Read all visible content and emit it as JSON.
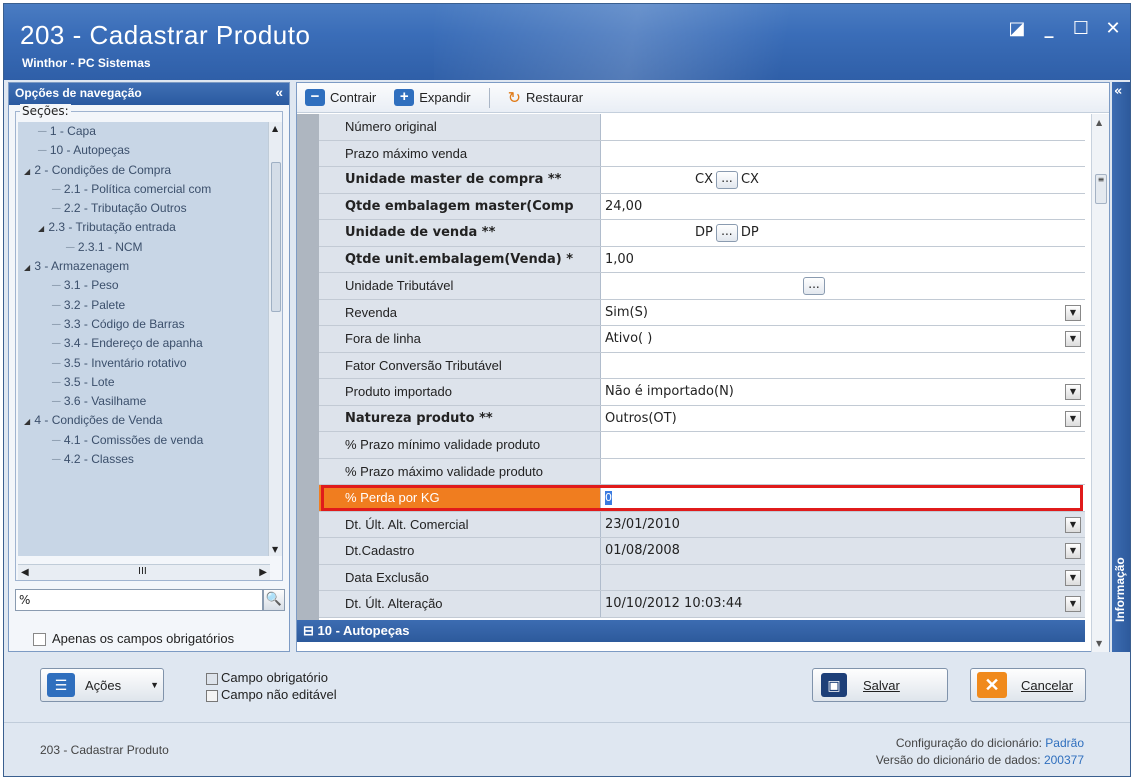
{
  "window": {
    "title": "203 - Cadastrar  Produto",
    "subtitle": "Winthor - PC Sistemas",
    "controls": [
      "◪",
      "_",
      "☐",
      "✕"
    ]
  },
  "nav": {
    "header": "Opções de navegação",
    "collapse": "«",
    "sections_label": "Seções:",
    "items": [
      {
        "label": "1 - Capa",
        "indent": 1,
        "tri": ""
      },
      {
        "label": "10 - Autopeças",
        "indent": 1,
        "tri": ""
      },
      {
        "label": "2 - Condições de Compra",
        "indent": 0,
        "tri": "◢"
      },
      {
        "label": "2.1 - Política comercial com",
        "indent": 2,
        "tri": ""
      },
      {
        "label": "2.2 - Tributação Outros",
        "indent": 2,
        "tri": ""
      },
      {
        "label": "2.3 - Tributação entrada",
        "indent": 1,
        "tri": "◢"
      },
      {
        "label": "2.3.1 - NCM",
        "indent": 3,
        "tri": ""
      },
      {
        "label": "3 - Armazenagem",
        "indent": 0,
        "tri": "◢"
      },
      {
        "label": "3.1 - Peso",
        "indent": 2,
        "tri": ""
      },
      {
        "label": "3.2 - Palete",
        "indent": 2,
        "tri": ""
      },
      {
        "label": "3.3 - Código de Barras",
        "indent": 2,
        "tri": ""
      },
      {
        "label": "3.4 - Endereço de apanha",
        "indent": 2,
        "tri": ""
      },
      {
        "label": "3.5 - Inventário rotativo",
        "indent": 2,
        "tri": ""
      },
      {
        "label": "3.5 - Lote",
        "indent": 2,
        "tri": ""
      },
      {
        "label": "3.6 - Vasilhame",
        "indent": 2,
        "tri": ""
      },
      {
        "label": "4 - Condições de Venda",
        "indent": 0,
        "tri": "◢"
      },
      {
        "label": "4.1 - Comissões de venda",
        "indent": 2,
        "tri": ""
      },
      {
        "label": "4.2 - Classes",
        "indent": 2,
        "tri": ""
      }
    ],
    "hscroll_mark": "III",
    "search_value": "%",
    "only_required_label": "Apenas os campos obrigatórios"
  },
  "toolbar": {
    "contrair": "Contrair",
    "expandir": "Expandir",
    "restaurar": "Restaurar"
  },
  "grid": {
    "rows": [
      {
        "label": "Número original",
        "value": "",
        "bold": false,
        "type": "text"
      },
      {
        "label": "Prazo máximo venda",
        "value": "",
        "bold": false,
        "type": "text"
      },
      {
        "label": "Unidade master de compra **",
        "value": "CX",
        "value2": "CX",
        "bold": true,
        "type": "lookup"
      },
      {
        "label": "Qtde embalagem master(Comp",
        "value": "24,00",
        "bold": true,
        "type": "text"
      },
      {
        "label": "Unidade de venda **",
        "value": "DP",
        "value2": "DP",
        "bold": true,
        "type": "lookup"
      },
      {
        "label": "Qtde unit.embalagem(Venda) *",
        "value": "1,00",
        "bold": true,
        "type": "text"
      },
      {
        "label": "Unidade Tributável",
        "value": "",
        "value2": "",
        "bold": false,
        "type": "lookup"
      },
      {
        "label": "Revenda",
        "value": "Sim(S)",
        "bold": false,
        "type": "dropdown"
      },
      {
        "label": "Fora de linha",
        "value": "Ativo( )",
        "bold": false,
        "type": "dropdown"
      },
      {
        "label": "Fator Conversão Tributável",
        "value": "",
        "bold": false,
        "type": "text"
      },
      {
        "label": "Produto importado",
        "value": "Não é importado(N)",
        "bold": false,
        "type": "dropdown"
      },
      {
        "label": "Natureza produto **",
        "value": "Outros(OT)",
        "bold": true,
        "type": "dropdown"
      },
      {
        "label": "% Prazo mínimo validade produto",
        "value": "",
        "bold": false,
        "type": "text"
      },
      {
        "label": "% Prazo máximo validade produto",
        "value": "",
        "bold": false,
        "type": "text"
      },
      {
        "label": "% Perda por KG",
        "value": "0",
        "bold": false,
        "type": "highlight"
      },
      {
        "label": "Dt. Últ. Alt. Comercial",
        "value": "23/01/2010",
        "bold": false,
        "type": "dropdown-grey"
      },
      {
        "label": "Dt.Cadastro",
        "value": "01/08/2008",
        "bold": false,
        "type": "dropdown-grey"
      },
      {
        "label": "Data Exclusão",
        "value": "",
        "bold": false,
        "type": "dropdown-grey"
      },
      {
        "label": "Dt. Últ. Alteração",
        "value": "10/10/2012 10:03:44",
        "bold": false,
        "type": "dropdown-grey"
      }
    ],
    "group_label": "10 - Autopeças"
  },
  "info_strip": {
    "label": "Informação",
    "chev": "«"
  },
  "bottom": {
    "acoes": "Ações",
    "legend_required": "Campo obrigatório",
    "legend_noneditable": "Campo não editável",
    "salvar": "Salvar",
    "cancelar": "Cancelar"
  },
  "footer": {
    "left": "203 - Cadastrar  Produto",
    "dict_config_label": "Configuração do dicionário:",
    "dict_config_value": "Padrão",
    "dict_version_label": "Versão do dicionário de dados:",
    "dict_version_value": "200377"
  },
  "colors": {
    "title_bar": "#3a6db8",
    "highlight_label": "#f07d1f",
    "red_outline": "#e01b1b",
    "group_row": "#2d5a9c"
  }
}
